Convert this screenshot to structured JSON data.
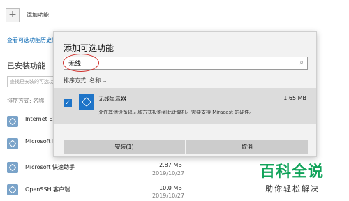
{
  "background": {
    "add_feature_label": "添加功能",
    "history_link": "查看可选功能历史记录",
    "installed_title": "已安装功能",
    "search_placeholder": "查找已安装的可选功能",
    "sort_label": "排序方式: 名称",
    "items": [
      {
        "name": "Internet Exp",
        "size": "",
        "date": ""
      },
      {
        "name": "Microsoft P",
        "size": "",
        "date": ""
      },
      {
        "name": "Microsoft 快速助手",
        "size": "2.87 MB",
        "date": "2019/10/27"
      },
      {
        "name": "OpenSSH 客户端",
        "size": "10.0 MB",
        "date": "2019/10/27"
      }
    ]
  },
  "dialog": {
    "title": "添加可选功能",
    "search_value": "无线",
    "sort_label": "排序方式: 名称",
    "item": {
      "name": "无线显示器",
      "size": "1.65 MB",
      "description": "允许其他设备以无线方式投影到此计算机。需要支持 Miracast 的硬件。",
      "checked": true
    },
    "install_label": "安装(1)",
    "cancel_label": "取消"
  },
  "watermark": {
    "title": "百科全说",
    "subtitle": "助你轻松解决"
  },
  "colors": {
    "accent": "#1e74c8",
    "highlight_oval": "#d0312d",
    "watermark_green": "#11a35a"
  }
}
